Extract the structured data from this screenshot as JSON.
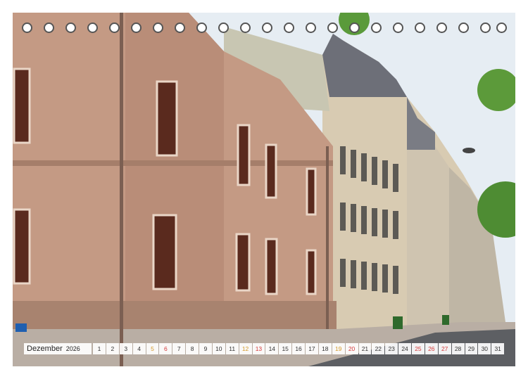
{
  "calendar": {
    "month": "Dezember",
    "year": "2026",
    "days": [
      {
        "n": "1",
        "kind": "wd"
      },
      {
        "n": "2",
        "kind": "wd"
      },
      {
        "n": "3",
        "kind": "wd"
      },
      {
        "n": "4",
        "kind": "wd"
      },
      {
        "n": "5",
        "kind": "sat"
      },
      {
        "n": "6",
        "kind": "sun"
      },
      {
        "n": "7",
        "kind": "wd"
      },
      {
        "n": "8",
        "kind": "wd"
      },
      {
        "n": "9",
        "kind": "wd"
      },
      {
        "n": "10",
        "kind": "wd"
      },
      {
        "n": "11",
        "kind": "wd"
      },
      {
        "n": "12",
        "kind": "sat"
      },
      {
        "n": "13",
        "kind": "sun"
      },
      {
        "n": "14",
        "kind": "wd"
      },
      {
        "n": "15",
        "kind": "wd"
      },
      {
        "n": "16",
        "kind": "wd"
      },
      {
        "n": "17",
        "kind": "wd"
      },
      {
        "n": "18",
        "kind": "wd"
      },
      {
        "n": "19",
        "kind": "sat"
      },
      {
        "n": "20",
        "kind": "sun"
      },
      {
        "n": "21",
        "kind": "wd"
      },
      {
        "n": "22",
        "kind": "wd"
      },
      {
        "n": "23",
        "kind": "wd"
      },
      {
        "n": "24",
        "kind": "wd"
      },
      {
        "n": "25",
        "kind": "hol"
      },
      {
        "n": "26",
        "kind": "hol"
      },
      {
        "n": "27",
        "kind": "sun"
      },
      {
        "n": "28",
        "kind": "wd"
      },
      {
        "n": "29",
        "kind": "wd"
      },
      {
        "n": "30",
        "kind": "wd"
      },
      {
        "n": "31",
        "kind": "wd"
      }
    ]
  },
  "colors": {
    "weekday": "#333333",
    "saturday": "#d49a2a",
    "sunday_holiday": "#d43a3a",
    "sandstone": "#c49a84",
    "sky": "#e4ebf2"
  }
}
